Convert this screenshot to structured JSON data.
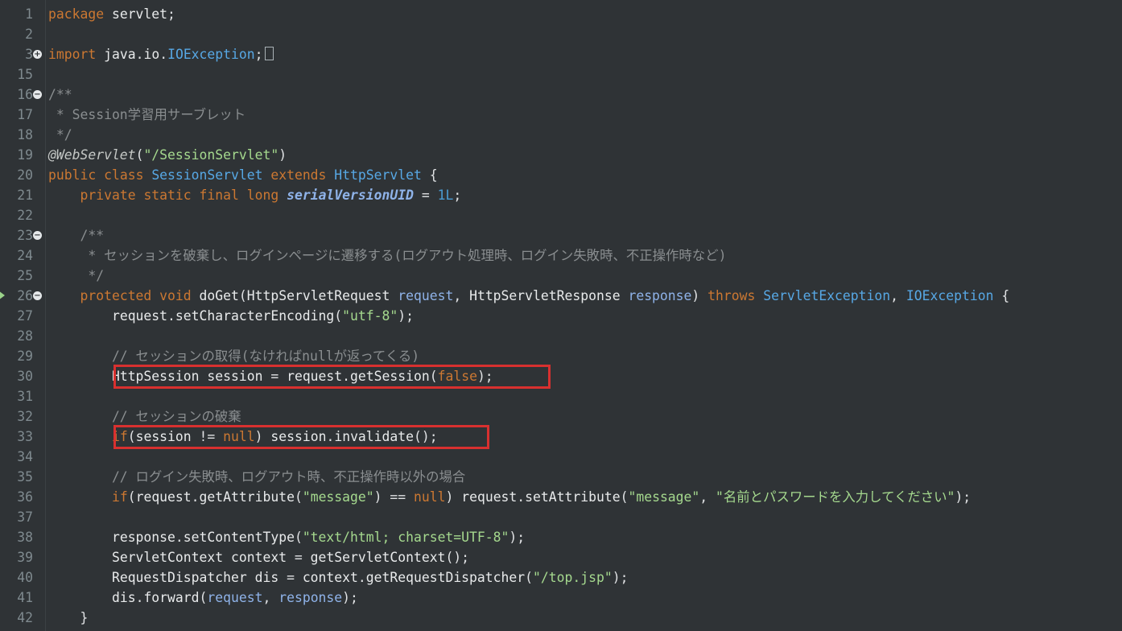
{
  "editor": {
    "language": "java",
    "lines": [
      {
        "n": "1",
        "fold": "",
        "text": "package servlet;"
      },
      {
        "n": "2",
        "fold": "",
        "text": ""
      },
      {
        "n": "3",
        "fold": "plus",
        "text": "import java.io.IOException;"
      },
      {
        "n": "15",
        "fold": "",
        "text": ""
      },
      {
        "n": "16",
        "fold": "minus",
        "text": "/**"
      },
      {
        "n": "17",
        "fold": "",
        "text": " * Session学習用サーブレット"
      },
      {
        "n": "18",
        "fold": "",
        "text": " */"
      },
      {
        "n": "19",
        "fold": "",
        "text": "@WebServlet(\"/SessionServlet\")"
      },
      {
        "n": "20",
        "fold": "",
        "text": "public class SessionServlet extends HttpServlet {"
      },
      {
        "n": "21",
        "fold": "",
        "text": "    private static final long serialVersionUID = 1L;"
      },
      {
        "n": "22",
        "fold": "",
        "text": ""
      },
      {
        "n": "23",
        "fold": "minus",
        "text": "    /**"
      },
      {
        "n": "24",
        "fold": "",
        "text": "     * セッションを破棄し、ログインページに遷移する(ログアウト処理時、ログイン失敗時、不正操作時など)"
      },
      {
        "n": "25",
        "fold": "",
        "text": "     */"
      },
      {
        "n": "26",
        "fold": "minus",
        "text": "    protected void doGet(HttpServletRequest request, HttpServletResponse response) throws ServletException, IOException {"
      },
      {
        "n": "27",
        "fold": "",
        "text": "        request.setCharacterEncoding(\"utf-8\");"
      },
      {
        "n": "28",
        "fold": "",
        "text": ""
      },
      {
        "n": "29",
        "fold": "",
        "text": "        // セッションの取得(なければnullが返ってくる)"
      },
      {
        "n": "30",
        "fold": "",
        "text": "        HttpSession session = request.getSession(false);"
      },
      {
        "n": "31",
        "fold": "",
        "text": ""
      },
      {
        "n": "32",
        "fold": "",
        "text": "        // セッションの破棄"
      },
      {
        "n": "33",
        "fold": "",
        "text": "        if(session != null) session.invalidate();"
      },
      {
        "n": "34",
        "fold": "",
        "text": ""
      },
      {
        "n": "35",
        "fold": "",
        "text": "        // ログイン失敗時、ログアウト時、不正操作時以外の場合"
      },
      {
        "n": "36",
        "fold": "",
        "text": "        if(request.getAttribute(\"message\") == null) request.setAttribute(\"message\", \"名前とパスワードを入力してください\");"
      },
      {
        "n": "37",
        "fold": "",
        "text": ""
      },
      {
        "n": "38",
        "fold": "",
        "text": "        response.setContentType(\"text/html; charset=UTF-8\");"
      },
      {
        "n": "39",
        "fold": "",
        "text": "        ServletContext context = getServletContext();"
      },
      {
        "n": "40",
        "fold": "",
        "text": "        RequestDispatcher dis = context.getRequestDispatcher(\"/top.jsp\");"
      },
      {
        "n": "41",
        "fold": "",
        "text": "        dis.forward(request, response);"
      },
      {
        "n": "42",
        "fold": "",
        "text": "    }"
      }
    ],
    "highlighted_lines": [
      "30",
      "33"
    ],
    "colors": {
      "background": "#2f3336",
      "keyword": "#cc7832",
      "type": "#57a8e5",
      "string": "#a5d98e",
      "comment": "#8a8e90",
      "highlight_box": "#d8302f"
    }
  }
}
